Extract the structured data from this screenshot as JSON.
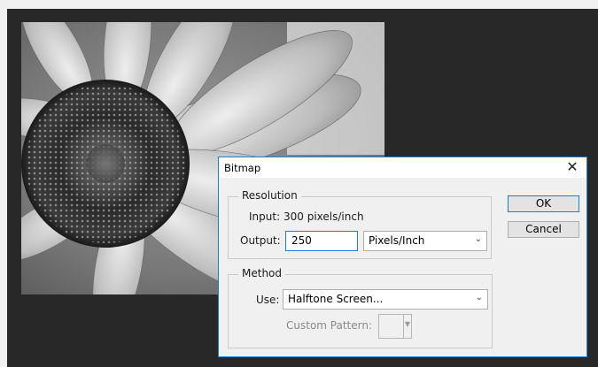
{
  "dialog": {
    "title": "Bitmap",
    "close_glyph": "✕"
  },
  "resolution": {
    "legend": "Resolution",
    "input_label": "Input:",
    "input_value": "300 pixels/inch",
    "output_label": "Output:",
    "output_value": "250",
    "unit_selected": "Pixels/Inch"
  },
  "method": {
    "legend": "Method",
    "use_label": "Use:",
    "use_selected": "Halftone Screen...",
    "custom_pattern_label": "Custom Pattern:"
  },
  "buttons": {
    "ok": "OK",
    "cancel": "Cancel"
  },
  "icons": {
    "close": "close-icon",
    "dropdown": "chevron-down-icon"
  },
  "colors": {
    "canvas_bg": "#282828",
    "dialog_bg": "#f0f0f0",
    "focus_blue": "#1f7dd6"
  }
}
